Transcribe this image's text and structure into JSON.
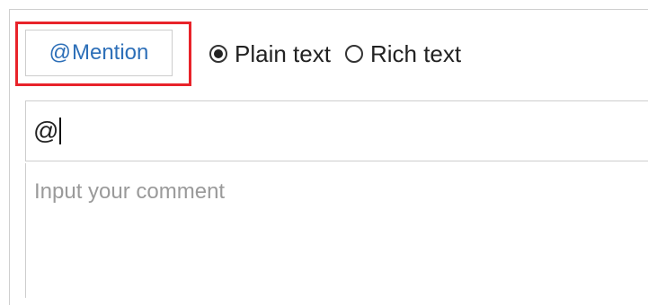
{
  "mention": {
    "label": "Mention",
    "at_symbol": "@",
    "color": "#2d6fb8"
  },
  "format_options": [
    {
      "label": "Plain text",
      "selected": true
    },
    {
      "label": "Rich text",
      "selected": false
    }
  ],
  "subject_input": {
    "value": "@"
  },
  "comment_input": {
    "placeholder": "Input your comment"
  },
  "highlight_color": "#e8232a"
}
